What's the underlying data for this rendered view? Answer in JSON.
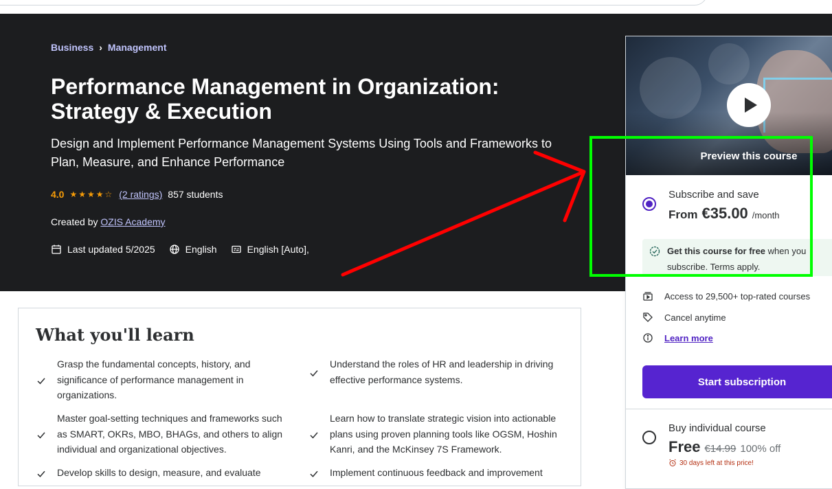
{
  "breadcrumb": [
    "Business",
    "Management"
  ],
  "course": {
    "title": "Performance Management in Organization: Strategy & Execution",
    "subtitle": "Design and Implement Performance Management Systems Using Tools and Frameworks to Plan, Measure, and Enhance Performance",
    "rating": "4.0",
    "stars": "★★★★☆",
    "ratings_link": "(2 ratings)",
    "students": "857 students",
    "created_by_label": "Created by",
    "author": "OZIS Academy",
    "last_updated": "Last updated 5/2025",
    "language": "English",
    "captions": "English [Auto],"
  },
  "learn": {
    "title": "What you'll learn",
    "items": [
      "Grasp the fundamental concepts, history, and significance of performance management in organizations.",
      "Understand the roles of HR and leadership in driving effective performance systems.",
      "Master goal-setting techniques and frameworks such as SMART, OKRs, MBO, BHAGs, and others to align individual and organizational objectives.",
      "Learn how to translate strategic vision into actionable plans using proven planning tools like OGSM, Hoshin Kanri, and the McKinsey 7S Framework.",
      "Develop skills to design, measure, and evaluate",
      "Implement continuous feedback and improvement"
    ]
  },
  "sidebar": {
    "preview_label": "Preview this course",
    "subscribe": {
      "title": "Subscribe and save",
      "from": "From",
      "price": "€35.00",
      "per": "/month"
    },
    "free_note": {
      "bold": "Get this course for free",
      "rest": " when you subscribe. Terms apply."
    },
    "features": [
      "Access to 29,500+ top-rated courses",
      "Cancel anytime",
      "Learn more"
    ],
    "start_button": "Start subscription",
    "individual": {
      "title": "Buy individual course",
      "price": "Free",
      "old_price": "€14.99",
      "discount": "100% off",
      "deadline": "30 days left at this price!"
    }
  },
  "colors": {
    "hero_bg": "#1c1d1f",
    "accent": "#5624d0",
    "link_light": "#c0c4fc",
    "star": "#f69c08",
    "annotation_box": "#00ff00",
    "annotation_arrow": "#ff0000"
  }
}
